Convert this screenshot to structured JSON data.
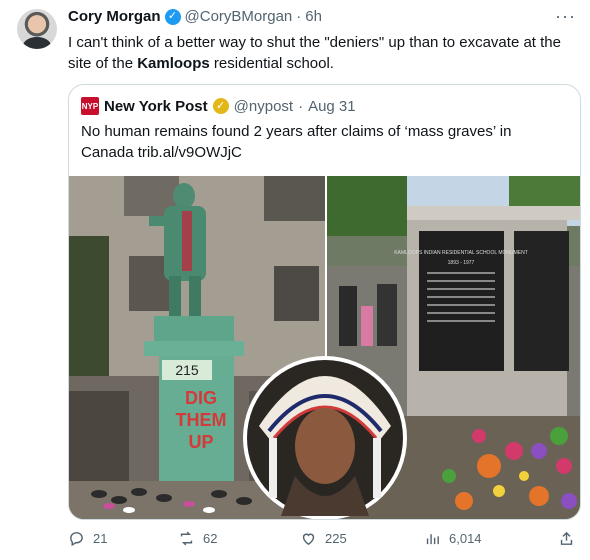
{
  "tweet": {
    "author_name": "Cory Morgan",
    "handle": "@CoryBMorgan",
    "separator": "·",
    "time": "6h",
    "text_before": "I can't think of a better way to shut the \"deniers\" up than to excavate at the site of the ",
    "text_bold": "Kamloops",
    "text_after": " residential school.",
    "more_icon": "more-dots-icon"
  },
  "quote": {
    "logo_text": "NYP",
    "author_name": "New York Post",
    "handle": "@nypost",
    "separator": "·",
    "date": "Aug 31",
    "text": "No human remains found 2 years after claims of ‘mass graves’ in Canada trib.al/v9OWJjC"
  },
  "media": {
    "statue_sign": "215",
    "graffiti_words": [
      "DIG",
      "THEM",
      "UP"
    ],
    "monument_title": "KAMLOOPS INDIAN RESIDENTIAL SCHOOL MONUMENT",
    "monument_years": "1893 - 1977"
  },
  "actions": {
    "replies": "21",
    "retweets": "62",
    "likes": "225",
    "views": "6,014"
  },
  "colors": {
    "verified_blue": "#1d9bf0",
    "verified_gold": "#e2b719",
    "nyp_red": "#c8102e",
    "muted": "#536471"
  }
}
